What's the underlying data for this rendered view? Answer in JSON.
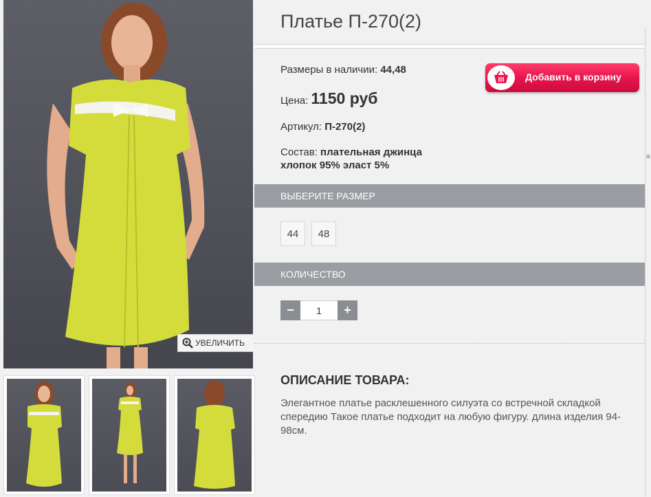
{
  "product": {
    "title": "Платье П-270(2)",
    "sizes_label": "Размеры в наличии:",
    "sizes_value": "44,48",
    "price_label": "Цена:",
    "price_value": "1150 руб",
    "sku_label": "Артикул:",
    "sku_value": "П-270(2)",
    "composition_label": "Состав:",
    "composition_line1": "плательная джинца",
    "composition_line2": "хлопок 95% эласт 5%"
  },
  "cart": {
    "button_label": "Добавить в корзину",
    "icon": "basket-icon"
  },
  "zoom": {
    "label": "УВЕЛИЧИТЬ",
    "icon": "zoom-in-icon"
  },
  "size_section": {
    "header": "ВЫБЕРИТЕ РАЗМЕР",
    "options": [
      "44",
      "48"
    ]
  },
  "quantity_section": {
    "header": "КОЛИЧЕСТВО",
    "minus": "−",
    "plus": "+",
    "value": "1"
  },
  "description": {
    "title": "ОПИСАНИЕ ТОВАРА:",
    "text": "Элегантное платье расклешенного силуэта со встречной складкой спередию Такое платье подходит на любую фигуру. длина изделия 94-98см."
  },
  "side_marker": "≡",
  "colors": {
    "dress": "#d4dc3c",
    "cart_button": "#e8154c",
    "section_bar": "#9a9da1",
    "photo_bg": "#55565e"
  }
}
